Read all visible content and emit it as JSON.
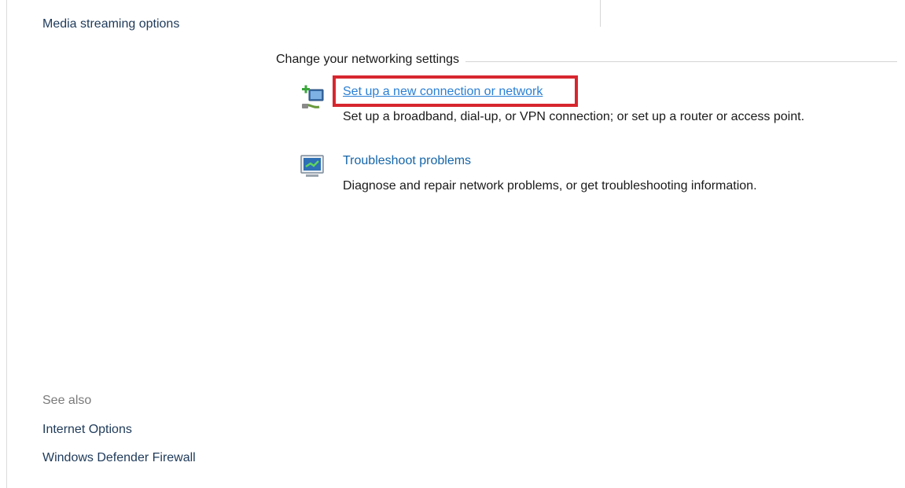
{
  "sidebar": {
    "media_streaming": "Media streaming options",
    "see_also_label": "See also",
    "see_also_links": [
      "Internet Options",
      "Windows Defender Firewall"
    ]
  },
  "main": {
    "section_title": "Change your networking settings",
    "tasks": [
      {
        "link": "Set up a new connection or network",
        "description": "Set up a broadband, dial-up, or VPN connection; or set up a router or access point.",
        "icon": "new-connection-icon"
      },
      {
        "link": "Troubleshoot problems",
        "description": "Diagnose and repair network problems, or get troubleshooting information.",
        "icon": "troubleshoot-icon"
      }
    ]
  },
  "colors": {
    "link": "#1565a8",
    "highlight": "#d7262e",
    "sidebar_link": "#1e3a5a"
  }
}
